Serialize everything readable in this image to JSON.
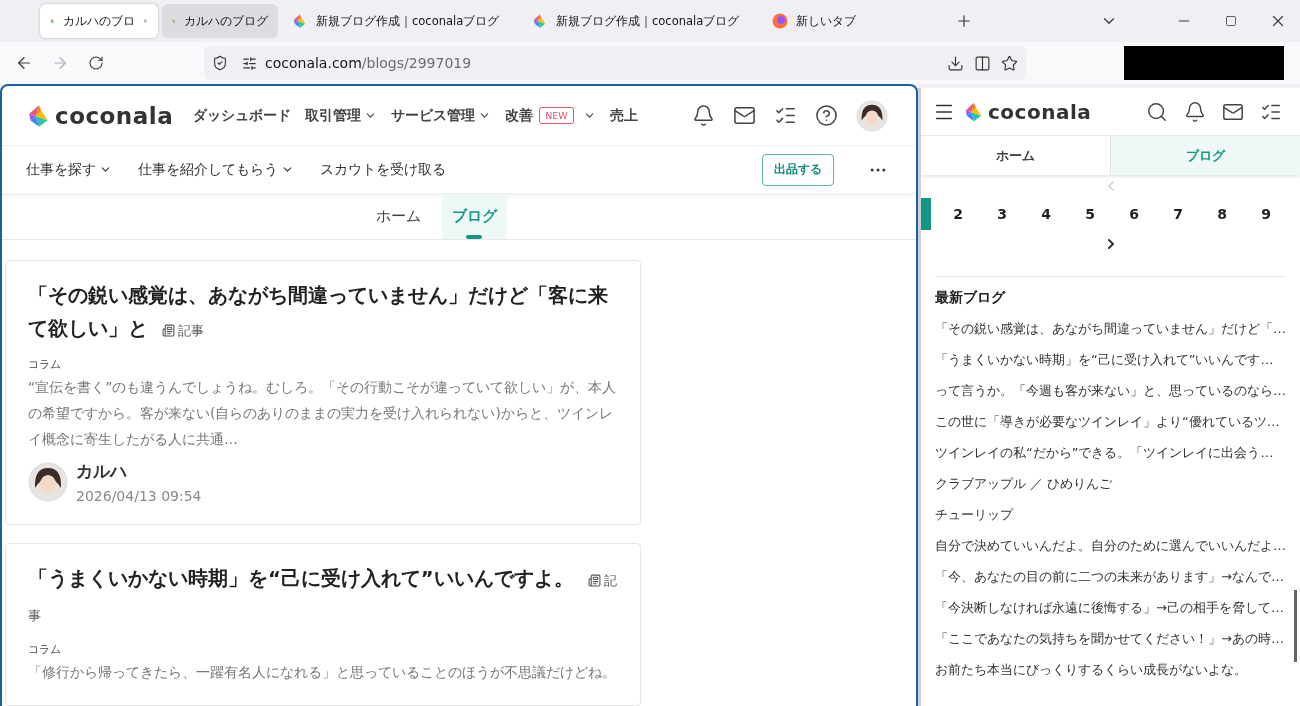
{
  "browser": {
    "tabs": [
      {
        "title": "カルハのブロ",
        "kind": "site",
        "selected": true,
        "hovered": false,
        "closable": true
      },
      {
        "title": "カルハのブログ",
        "kind": "site",
        "selected": false,
        "hovered": true,
        "closable": false
      },
      {
        "title": "新規ブログ作成｜coconalaブログ",
        "kind": "site",
        "selected": false,
        "hovered": false,
        "closable": false
      },
      {
        "title": "新規ブログ作成｜coconalaブログ",
        "kind": "site",
        "selected": false,
        "hovered": false,
        "closable": false
      },
      {
        "title": "新しいタブ",
        "kind": "newtab",
        "selected": false,
        "hovered": false,
        "closable": false
      }
    ],
    "url_host": "coconala.com",
    "url_path": "/blogs/2997019"
  },
  "main": {
    "logo": "coconala",
    "nav": [
      {
        "label": "ダッシュボード",
        "dropdown": false
      },
      {
        "label": "取引管理",
        "dropdown": true
      },
      {
        "label": "サービス管理",
        "dropdown": true
      },
      {
        "label": "改善",
        "badge": "NEW",
        "dropdown": true
      },
      {
        "label": "売上",
        "dropdown": false
      }
    ],
    "subnav": [
      {
        "label": "仕事を探す",
        "dropdown": true
      },
      {
        "label": "仕事を紹介してもらう",
        "dropdown": true
      },
      {
        "label": "スカウトを受け取る",
        "dropdown": false
      }
    ],
    "publish_button": "出品する",
    "tabs": [
      {
        "label": "ホーム",
        "selected": false
      },
      {
        "label": "ブログ",
        "selected": true
      }
    ],
    "posts": [
      {
        "title": "「その鋭い感覚は、あながち間違っていません」だけど「客に来て欲しい」と",
        "tag": "記事",
        "category": "コラム",
        "excerpt": "“宣伝を書く”のも違うんでしょうね。むしろ。「その行動こそが違っていて欲しい」が、本人の希望ですから。客が来ない(自らのありのままの実力を受け入れられない)からと、ツインレイ概念に寄生したがる人に共通…",
        "author": "カルハ",
        "date": "2026/04/13 09:54"
      },
      {
        "title": "「うまくいかない時期」を“己に受け入れて”いいんですよ。",
        "tag": "記事",
        "category": "コラム",
        "excerpt": "「修行から帰ってきたら、一躍有名人になれる」と思っていることのほうが不思議だけどね。"
      }
    ]
  },
  "side": {
    "logo": "coconala",
    "tabs": [
      {
        "label": "ホーム",
        "selected": false
      },
      {
        "label": "ブログ",
        "selected": true
      }
    ],
    "pages": [
      {
        "label": "2",
        "selected": false
      },
      {
        "label": "3",
        "selected": false
      },
      {
        "label": "4",
        "selected": false
      },
      {
        "label": "5",
        "selected": false
      },
      {
        "label": "6",
        "selected": false
      },
      {
        "label": "7",
        "selected": false
      },
      {
        "label": "8",
        "selected": false
      },
      {
        "label": "9",
        "selected": false
      }
    ],
    "latest_title": "最新ブログ",
    "latest": [
      "「その鋭い感覚は、あながち間違っていません」だけど「…",
      "「うまくいかない時期」を“己に受け入れて”いいんです…",
      "って言うか。「今週も客が来ない」と、思っているのなら…",
      "この世に「導きが必要なツインレイ」より“優れているツ…",
      "ツインレイの私“だから”できる。「ツインレイに出会う…",
      "クラブアップル ／ ひめりんご",
      "チューリップ",
      "自分で決めていいんだよ。自分のために選んでいいんだよ…",
      "「今、あなたの目の前に二つの未来があります」→なんで…",
      "「今決断しなければ永遠に後悔する」→己の相手を脅して…",
      "「ここであなたの気持ちを聞かせてください！」→あの時…",
      "お前たち本当にびっくりするくらい成長がないよな。"
    ]
  }
}
